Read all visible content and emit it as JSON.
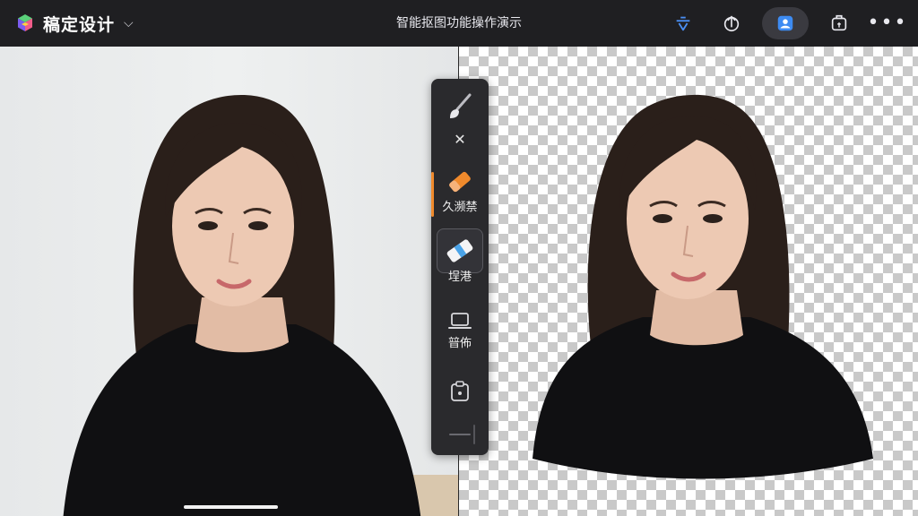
{
  "app": {
    "brand": "稿定设计",
    "title": "智能抠图功能操作演示"
  },
  "toolbar": {
    "items": [
      {
        "name": "crop-tool-icon"
      },
      {
        "name": "upload-icon"
      },
      {
        "name": "cutout-icon",
        "active": true
      },
      {
        "name": "image-export-icon"
      },
      {
        "name": "more-icon"
      }
    ]
  },
  "panel": {
    "items": [
      {
        "label": "",
        "icon": "brush-icon"
      },
      {
        "label": "",
        "icon": "close-icon"
      },
      {
        "label": "久濒禁",
        "icon": "eraser-orange-icon"
      },
      {
        "label": "埕港",
        "icon": "eraser-blue-icon"
      },
      {
        "label": "暜佈",
        "icon": "laptop-icon"
      },
      {
        "label": "",
        "icon": "clipboard-icon"
      }
    ]
  },
  "colors": {
    "topbar": "#1f1f22",
    "accent_orange": "#f08a2c",
    "active_blue": "#3d8bf2",
    "panel": "#2a2a2d"
  }
}
